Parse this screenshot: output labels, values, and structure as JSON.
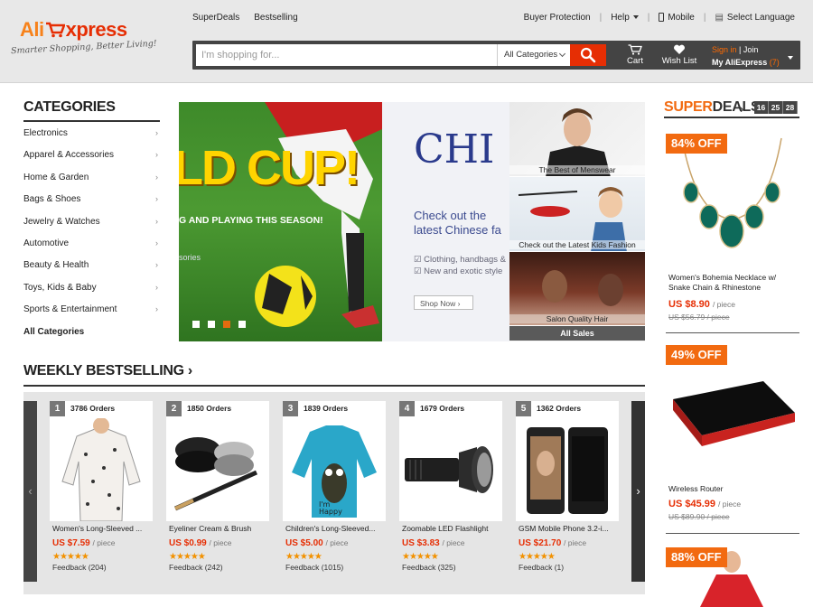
{
  "header": {
    "logo": {
      "ali": "Ali",
      "express": "xpress",
      "tagline": "Smarter Shopping, Better Living!"
    },
    "nav_left": [
      "SuperDeals",
      "Bestselling"
    ],
    "nav_right": {
      "buyer_protection": "Buyer Protection",
      "help": "Help",
      "mobile": "Mobile",
      "language": "Select Language"
    },
    "search": {
      "placeholder": "I'm shopping for...",
      "category": "All Categories"
    },
    "cart_label": "Cart",
    "wishlist_label": "Wish List",
    "account": {
      "sign_in": "Sign in",
      "join": "Join",
      "my_aliexpress": "My AliExpress",
      "count": "(7)"
    }
  },
  "categories": {
    "title": "CATEGORIES",
    "items": [
      "Electronics",
      "Apparel & Accessories",
      "Home & Garden",
      "Bags & Shoes",
      "Jewelry & Watches",
      "Automotive",
      "Beauty & Health",
      "Toys, Kids & Baby",
      "Sports & Entertainment"
    ],
    "all": "All Categories"
  },
  "banner": {
    "worldcup": {
      "big": "LD CUP!",
      "sub": "G AND PLAYING THIS SEASON!",
      "small": "sories"
    },
    "chinese": {
      "big": "CHI STYL",
      "sub_1": "Check out the",
      "sub_2": "latest Chinese fa",
      "bullet_1": "Clothing, handbags &",
      "bullet_2": "New and exotic style",
      "shop_now": "Shop Now"
    },
    "minis": [
      "The Best of Menswear",
      "Check out the Latest Kids Fashion",
      "Salon Quality Hair"
    ],
    "all_sales": "All Sales",
    "active_dot": 3
  },
  "weekly": {
    "title": "WEEKLY BESTSELLING",
    "products": [
      {
        "rank": "1",
        "orders": "3786 Orders",
        "name": "Women's Long-Sleeved ...",
        "price": "US $7.59",
        "unit": "/ piece",
        "stars": "★★★★★",
        "feedback": "Feedback (204)"
      },
      {
        "rank": "2",
        "orders": "1850 Orders",
        "name": "Eyeliner Cream & Brush",
        "price": "US $0.99",
        "unit": "/ piece",
        "stars": "★★★★★",
        "feedback": "Feedback (242)"
      },
      {
        "rank": "3",
        "orders": "1839 Orders",
        "name": "Children's Long-Sleeved...",
        "price": "US $5.00",
        "unit": "/ piece",
        "stars": "★★★★★",
        "feedback": "Feedback (1015)"
      },
      {
        "rank": "4",
        "orders": "1679 Orders",
        "name": "Zoomable LED Flashlight",
        "price": "US $3.83",
        "unit": "/ piece",
        "stars": "★★★★★",
        "feedback": "Feedback (325)"
      },
      {
        "rank": "5",
        "orders": "1362 Orders",
        "name": "GSM Mobile Phone 3.2-i...",
        "price": "US $21.70",
        "unit": "/ piece",
        "stars": "★★★★★",
        "feedback": "Feedback (1)"
      }
    ]
  },
  "superdeals": {
    "super": "SUPER",
    "deals": "DEALS",
    "timer": [
      "16",
      "25",
      "28"
    ],
    "items": [
      {
        "discount": "84% OFF",
        "name": "Women's Bohemia Necklace w/ Snake Chain & Rhinestone",
        "price": "US $8.90",
        "unit": "/ piece",
        "old": "US $56.79 / piece"
      },
      {
        "discount": "49% OFF",
        "name": "Wireless Router",
        "price": "US $45.99",
        "unit": "/ piece",
        "old": "US $89.90 / piece"
      },
      {
        "discount": "88% OFF"
      }
    ]
  },
  "colors": {
    "brand_red": "#e62e04",
    "brand_orange": "#f26a10",
    "header_bg": "#e8e8e8"
  }
}
